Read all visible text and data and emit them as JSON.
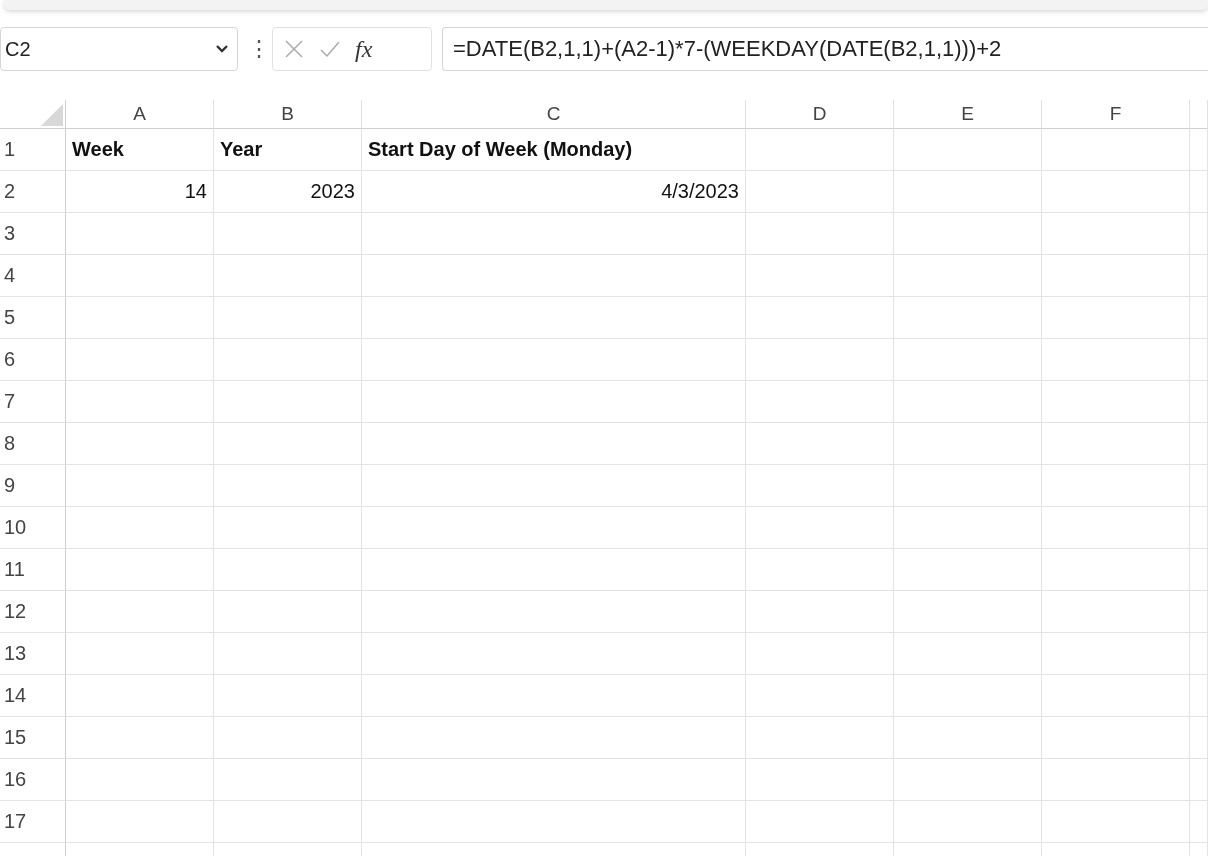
{
  "name_box": {
    "value": "C2"
  },
  "formula_bar": {
    "separator": "⋮",
    "fx": "fx",
    "formula": "=DATE(B2,1,1)+(A2-1)*7-(WEEKDAY(DATE(B2,1,1)))+2"
  },
  "columns": [
    "A",
    "B",
    "C",
    "D",
    "E",
    "F"
  ],
  "rows": [
    {
      "header": "1",
      "bold": true,
      "cells": [
        {
          "value": "Week",
          "kind": "text"
        },
        {
          "value": "Year",
          "kind": "text"
        },
        {
          "value": "Start Day of Week (Monday)",
          "kind": "text"
        }
      ]
    },
    {
      "header": "2",
      "bold": false,
      "cells": [
        {
          "value": "14",
          "kind": "number"
        },
        {
          "value": "2023",
          "kind": "number"
        },
        {
          "value": "4/3/2023",
          "kind": "number"
        }
      ]
    },
    {
      "header": "3"
    },
    {
      "header": "4"
    },
    {
      "header": "5"
    },
    {
      "header": "6"
    },
    {
      "header": "7"
    },
    {
      "header": "8"
    },
    {
      "header": "9"
    },
    {
      "header": "10"
    },
    {
      "header": "11"
    },
    {
      "header": "12"
    },
    {
      "header": "13"
    },
    {
      "header": "14"
    },
    {
      "header": "15"
    },
    {
      "header": "16"
    },
    {
      "header": "17"
    }
  ]
}
